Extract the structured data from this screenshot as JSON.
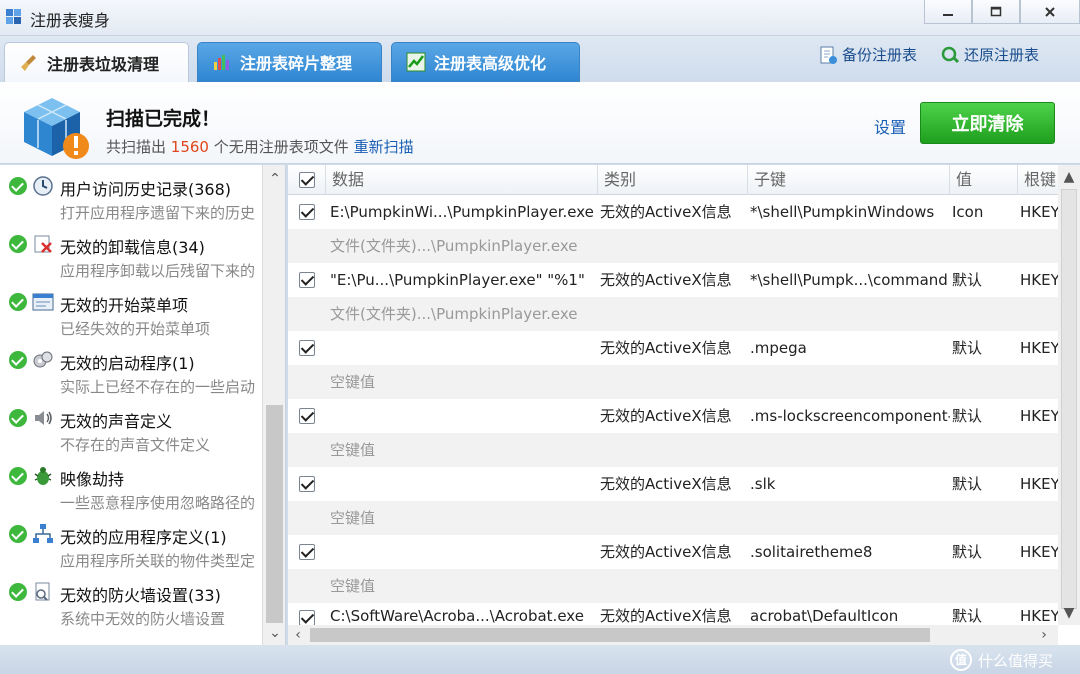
{
  "window": {
    "title": "注册表瘦身"
  },
  "tabs": [
    {
      "label": "注册表垃圾清理"
    },
    {
      "label": "注册表碎片整理"
    },
    {
      "label": "注册表高级优化"
    }
  ],
  "top_links": {
    "backup": "备份注册表",
    "restore": "还原注册表"
  },
  "header": {
    "title": "扫描已完成！",
    "sub_prefix": "共扫描出",
    "count": "1560",
    "sub_suffix": "个无用注册表项文件",
    "rescan": "重新扫描",
    "settings": "设置",
    "clean_button": "立即清除"
  },
  "categories": [
    {
      "name": "用户访问历史记录(368)",
      "desc": "打开应用程序遗留下来的历史",
      "icon": "history-icon"
    },
    {
      "name": "无效的卸载信息(34)",
      "desc": "应用程序卸载以后残留下来的",
      "icon": "uninstall-icon"
    },
    {
      "name": "无效的开始菜单项",
      "desc": "已经失效的开始菜单项",
      "icon": "start-menu-icon"
    },
    {
      "name": "无效的启动程序(1)",
      "desc": "实际上已经不存在的一些启动",
      "icon": "startup-icon"
    },
    {
      "name": "无效的声音定义",
      "desc": "不存在的声音文件定义",
      "icon": "sound-icon"
    },
    {
      "name": "映像劫持",
      "desc": "一些恶意程序使用忽略路径的",
      "icon": "bug-icon"
    },
    {
      "name": "无效的应用程序定义(1)",
      "desc": "应用程序所关联的物件类型定",
      "icon": "network-icon"
    },
    {
      "name": "无效的防火墙设置(33)",
      "desc": "系统中无效的防火墙设置",
      "icon": "firewall-icon"
    }
  ],
  "grid": {
    "columns": {
      "data": "数据",
      "type": "类别",
      "key": "子键",
      "value": "值",
      "root": "根键"
    },
    "rows": [
      {
        "data": "E:\\PumpkinWi...\\PumpkinPlayer.exe",
        "type": "无效的ActiveX信息",
        "key": "*\\shell\\PumpkinWindows",
        "value": "Icon",
        "root": "HKEY",
        "detail": "文件(文件夹)...\\PumpkinPlayer.exe"
      },
      {
        "data": "\"E:\\Pu...\\PumpkinPlayer.exe\" \"%1\"",
        "type": "无效的ActiveX信息",
        "key": "*\\shell\\Pumpk...\\command",
        "value": "默认",
        "root": "HKEY",
        "detail": "文件(文件夹)...\\PumpkinPlayer.exe"
      },
      {
        "data": "",
        "type": "无效的ActiveX信息",
        "key": ".mpega",
        "value": "默认",
        "root": "HKEY",
        "detail": "空键值"
      },
      {
        "data": "",
        "type": "无效的ActiveX信息",
        "key": ".ms-lockscreencomponent-",
        "value": "默认",
        "root": "HKEY",
        "detail": "空键值"
      },
      {
        "data": "",
        "type": "无效的ActiveX信息",
        "key": ".slk",
        "value": "默认",
        "root": "HKEY",
        "detail": "空键值"
      },
      {
        "data": "",
        "type": "无效的ActiveX信息",
        "key": ".solitairetheme8",
        "value": "默认",
        "root": "HKEY",
        "detail": "空键值"
      },
      {
        "data": "C:\\SoftWare\\Acroba...\\Acrobat.exe",
        "type": "无效的ActiveX信息",
        "key": "acrobat\\DefaultIcon",
        "value": "默认",
        "root": "HKEY"
      }
    ]
  },
  "watermark": {
    "text": "什么值得买",
    "logo": "值"
  },
  "colors": {
    "accent_green": "#2bb52b",
    "tab_blue": "#3a8fd8",
    "count_red": "#e0451b",
    "link_blue": "#1a5fb4"
  }
}
